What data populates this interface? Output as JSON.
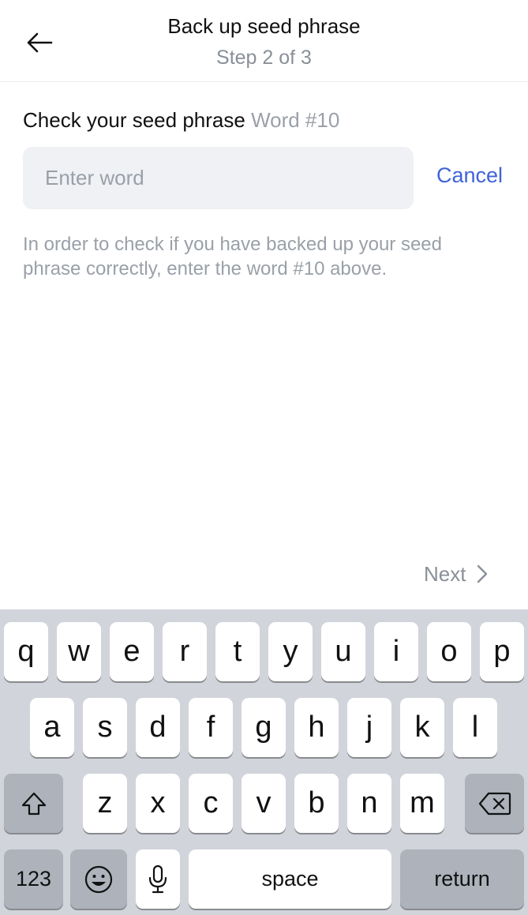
{
  "header": {
    "title": "Back up seed phrase",
    "step": "Step 2 of 3"
  },
  "check": {
    "label": "Check your seed phrase",
    "word_number": "Word #10"
  },
  "input": {
    "placeholder": "Enter word",
    "value": ""
  },
  "cancel_label": "Cancel",
  "help_text": "In order to check if you have backed up your seed phrase correctly, enter the word #10 above.",
  "next_label": "Next",
  "keyboard": {
    "row1": [
      "q",
      "w",
      "e",
      "r",
      "t",
      "y",
      "u",
      "i",
      "o",
      "p"
    ],
    "row2": [
      "a",
      "s",
      "d",
      "f",
      "g",
      "h",
      "j",
      "k",
      "l"
    ],
    "row3": [
      "z",
      "x",
      "c",
      "v",
      "b",
      "n",
      "m"
    ],
    "numbers_label": "123",
    "space_label": "space",
    "return_label": "return"
  },
  "colors": {
    "accent": "#3f63d9",
    "muted_text": "#9aa0a8",
    "input_bg": "#eff1f4",
    "keyboard_bg": "#d1d4da",
    "key_dark": "#adb2bb"
  }
}
